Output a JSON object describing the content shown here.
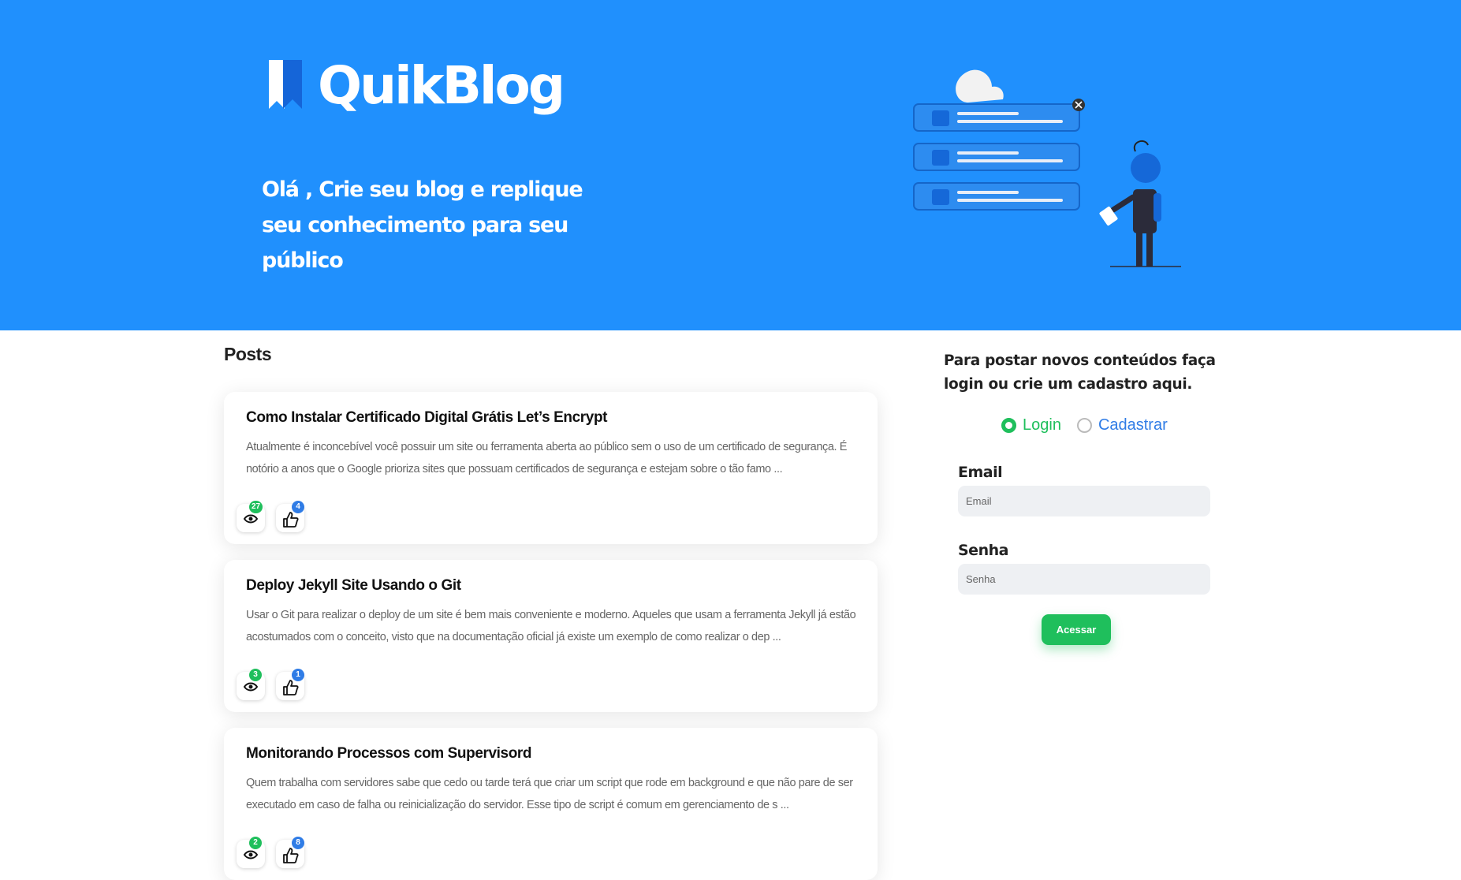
{
  "colors": {
    "hero_bg": "#2090fd",
    "accent_green": "#1fbf5c",
    "accent_blue": "#2f7ce6"
  },
  "hero": {
    "brand": "QuikBlog",
    "tagline": "Olá , Crie seu blog e replique seu conhecimento para seu público"
  },
  "posts": {
    "title": "Posts",
    "items": [
      {
        "title": "Como Instalar Certificado Digital Grátis Let’s Encrypt",
        "excerpt": "Atualmente é inconcebível você possuir um site ou ferramenta aberta ao público sem o uso de um certificado de segurança. É notório a anos que o Google prioriza sites que possuam certificados de segurança e estejam sobre o tão famo ...",
        "views": "27",
        "likes": "4"
      },
      {
        "title": "Deploy Jekyll Site Usando o Git",
        "excerpt": "Usar o Git para realizar o deploy de um site é bem mais conveniente e moderno. Aqueles que usam a ferramenta Jekyll já estão acostumados com o conceito, visto que na documentação oficial já existe um exemplo de como realizar o dep ...",
        "views": "3",
        "likes": "1"
      },
      {
        "title": "Monitorando Processos com Supervisord",
        "excerpt": "Quem trabalha com servidores sabe que cedo ou tarde terá que criar um script que rode em background e que não pare de ser executado em caso de falha ou reinicialização do servidor. Esse tipo de script é comum em gerenciamento de s ...",
        "views": "2",
        "likes": "8"
      }
    ]
  },
  "auth": {
    "heading": "Para postar novos conteúdos faça login ou crie um cadastro aqui.",
    "mode_login": "Login",
    "mode_register": "Cadastrar",
    "email_label": "Email",
    "email_placeholder": "Email",
    "password_label": "Senha",
    "password_placeholder": "Senha",
    "submit_label": "Acessar"
  }
}
